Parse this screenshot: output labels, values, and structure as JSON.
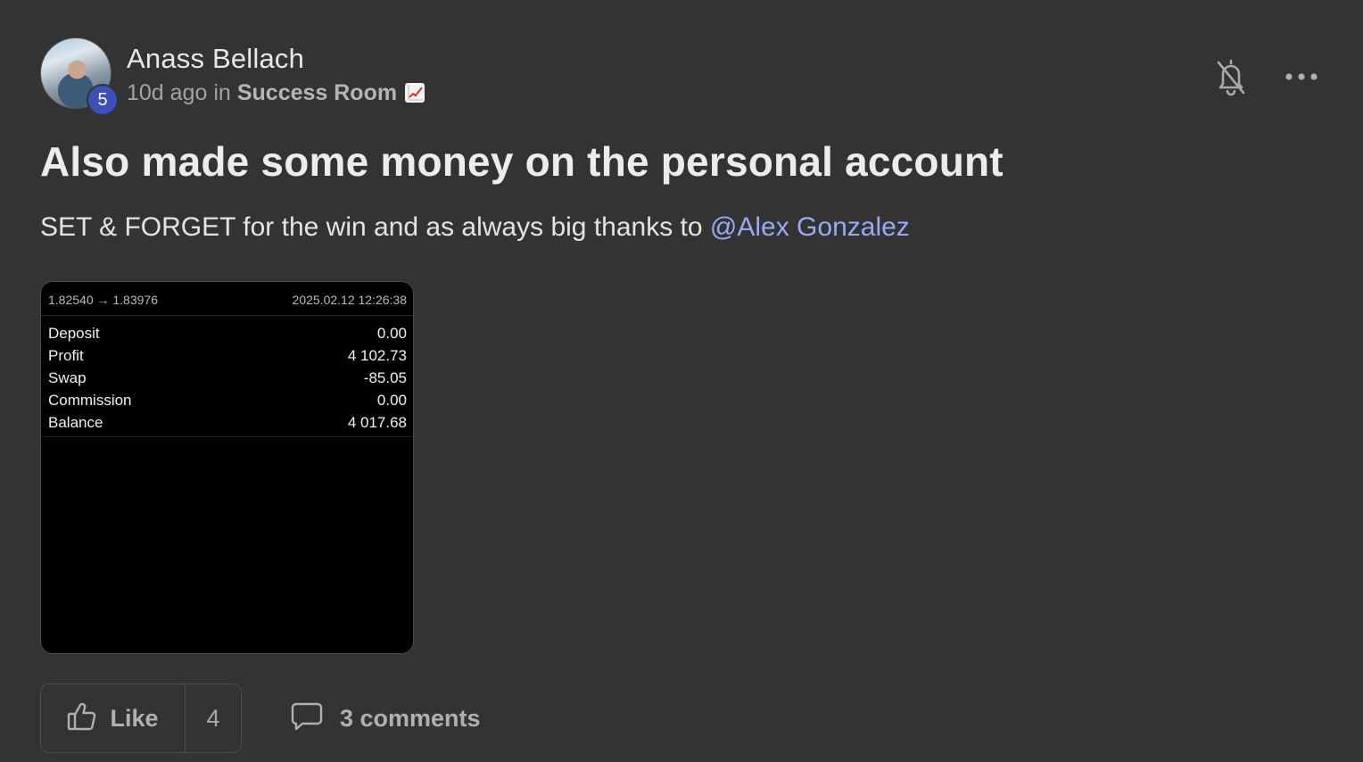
{
  "post": {
    "author": "Anass Bellach",
    "level": "5",
    "time_ago": "10d ago",
    "in_word": "in",
    "group": "Success Room",
    "group_emoji": "chart-increasing-emoji",
    "title": "Also made some money on the personal account",
    "body_prefix": "SET & FORGET for the win and as always big thanks to ",
    "mention": "@Alex Gonzalez"
  },
  "attachment": {
    "route": "1.82540 → 1.83976",
    "datetime": "2025.02.12 12:26:38",
    "rows": [
      {
        "label": "Deposit",
        "value": "0.00"
      },
      {
        "label": "Profit",
        "value": "4 102.73"
      },
      {
        "label": "Swap",
        "value": "-85.05"
      },
      {
        "label": "Commission",
        "value": "0.00"
      },
      {
        "label": "Balance",
        "value": "4 017.68"
      }
    ]
  },
  "actions": {
    "like_label": "Like",
    "like_count": "4",
    "comments_label": "3 comments"
  },
  "icons": {
    "bell": "bell-off-icon",
    "more": "more-horizontal-icon",
    "like": "thumbs-up-icon",
    "comment": "comment-icon"
  },
  "colors": {
    "background": "#333333",
    "mention": "#9aa9f0",
    "level_badge": "#3d4fb8"
  }
}
